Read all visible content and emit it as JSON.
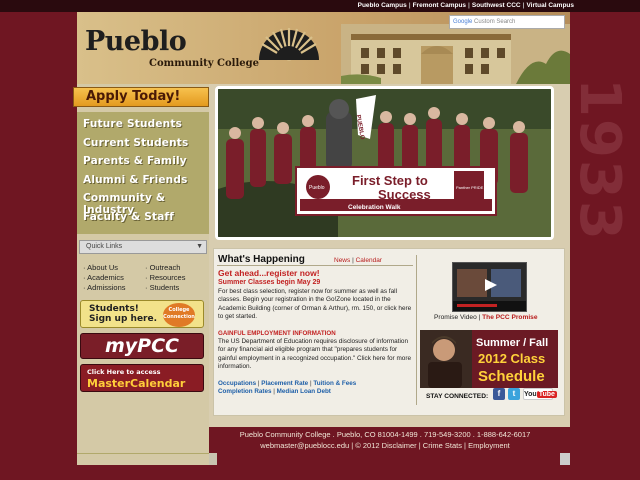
{
  "topbar": {
    "links": [
      "Pueblo Campus",
      "Fremont Campus",
      "Southwest CCC",
      "Virtual Campus"
    ]
  },
  "watermark_year": "1933",
  "header": {
    "logo_word": "Pueblo",
    "logo_sub": "Community College",
    "search_brand": "Google",
    "search_placeholder": "Custom Search"
  },
  "apply_label": "Apply Today!",
  "nav": {
    "items": [
      "Future Students",
      "Current Students",
      "Parents & Family",
      "Alumni & Friends",
      "Community & Industry",
      "Faculty & Staff"
    ]
  },
  "quick_links": {
    "label": "Quick Links",
    "items": [
      "About Us",
      "Outreach",
      "Academics",
      "Resources",
      "Admissions",
      "Students"
    ]
  },
  "promos": {
    "students_line1": "Students!",
    "students_line2": "Sign up here.",
    "students_badge": "College Connection",
    "mypcc": "myPCC",
    "calendar_small": "Click Here to access",
    "calendar_big": "MasterCalendar"
  },
  "hero": {
    "banner_line1": "First Step to",
    "banner_line2": "Success",
    "banner_sub": "Celebration Walk",
    "sign_text": "PUEBLO",
    "banner_left_logo": "Pueblo",
    "banner_right_logo": "Panther PRIDE"
  },
  "whats_happening": {
    "title": "What's Happening",
    "links": [
      "News",
      "Calendar"
    ],
    "headline": "Get ahead...register now!",
    "subheadline": "Summer Classes begin May 29",
    "para1": "For best class selection, register now for summer as well as fall classes. Begin your registration in the Go!Zone located in the Academic Building (corner of Orman & Arthur), rm. 150, or click here to get started.",
    "heading2": "GAINFUL EMPLOYMENT INFORMATION",
    "para2": "The US Department of Education requires disclosure of information for any financial aid eligible program that \"prepares students for gainful employment in a recognized occupation.\" Click here for more information.",
    "bottom_links_row1": [
      "Occupations",
      "Placement Rate",
      "Tuition & Fees"
    ],
    "bottom_links_row2": [
      "Completion Rates",
      "Median Loan Debt"
    ]
  },
  "video": {
    "caption_prefix": "Promise Video",
    "caption_link": "The PCC Promise"
  },
  "schedule": {
    "line1": "Summer / Fall",
    "line2": "2012 Class",
    "line3": "Schedule"
  },
  "social": {
    "label": "STAY CONNECTED:",
    "fb": "f",
    "tw": "t",
    "yt_left": "You",
    "yt_right": "Tube"
  },
  "footer": {
    "line1": "Pueblo Community College . Pueblo, CO 81004-1499 . 719-549-3200 . 1-888-642-6017",
    "line2": "webmaster@pueblocc.edu | © 2012 Disclaimer | Crime Stats | Employment"
  },
  "colors": {
    "page_bg": "#6f1622",
    "accent_red": "#c22222",
    "link_blue": "#1e5fa8",
    "nav_olive": "#b1a96b"
  }
}
